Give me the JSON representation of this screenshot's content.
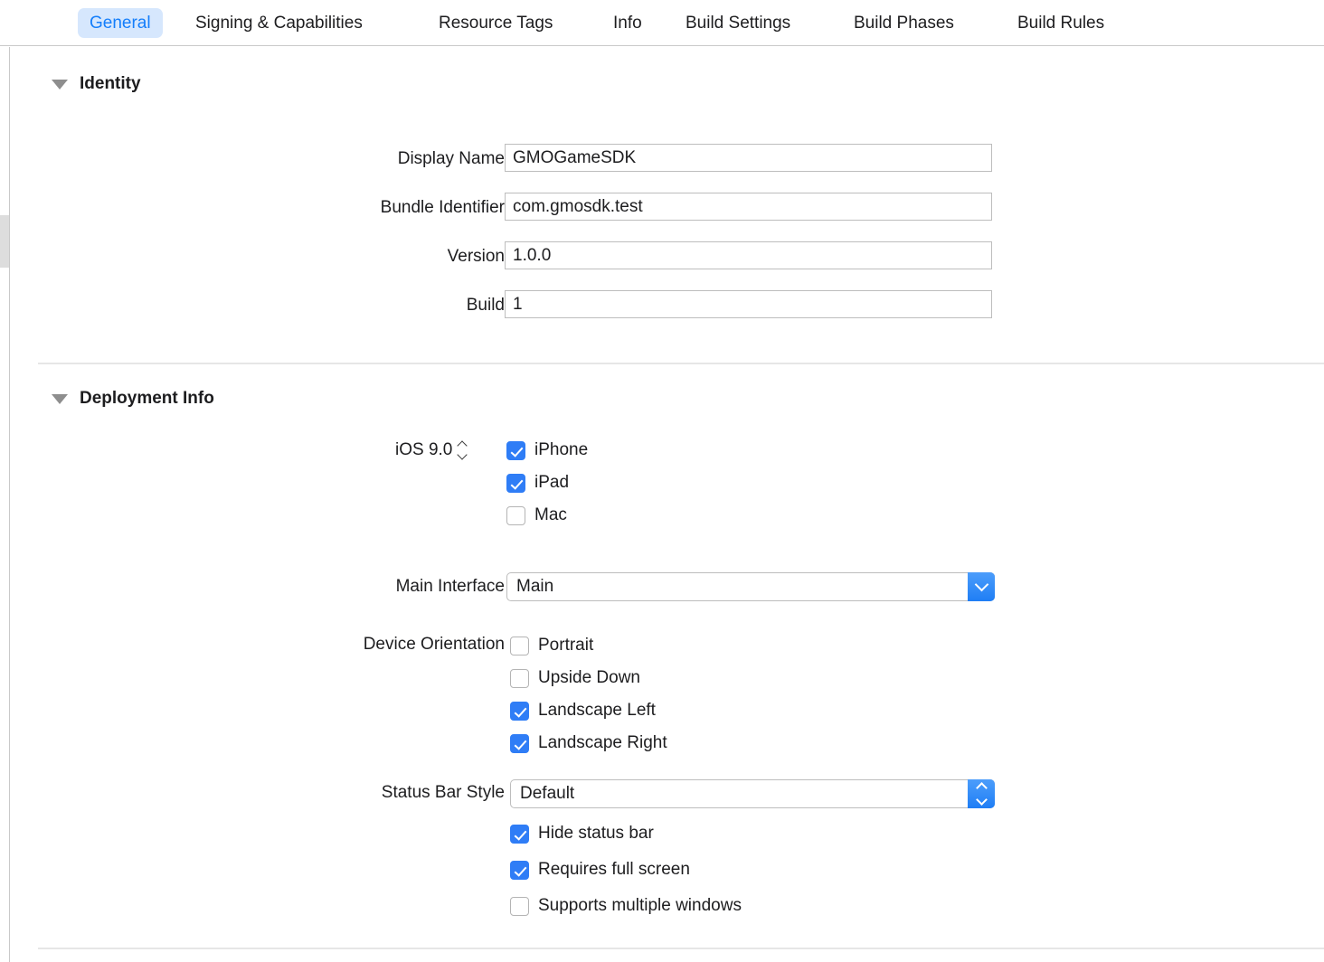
{
  "tabs": [
    {
      "label": "General",
      "selected": true
    },
    {
      "label": "Signing & Capabilities",
      "selected": false
    },
    {
      "label": "Resource Tags",
      "selected": false
    },
    {
      "label": "Info",
      "selected": false
    },
    {
      "label": "Build Settings",
      "selected": false
    },
    {
      "label": "Build Phases",
      "selected": false
    },
    {
      "label": "Build Rules",
      "selected": false
    }
  ],
  "identity": {
    "title": "Identity",
    "fields": [
      {
        "label": "Display Name",
        "value": "GMOGameSDK"
      },
      {
        "label": "Bundle Identifier",
        "value": "com.gmosdk.test"
      },
      {
        "label": "Version",
        "value": "1.0.0"
      },
      {
        "label": "Build",
        "value": "1"
      }
    ]
  },
  "deployment": {
    "title": "Deployment Info",
    "target_label": "iOS 9.0",
    "devices": [
      {
        "label": "iPhone",
        "checked": true
      },
      {
        "label": "iPad",
        "checked": true
      },
      {
        "label": "Mac",
        "checked": false
      }
    ],
    "main_interface": {
      "label": "Main Interface",
      "value": "Main"
    },
    "device_orientation": {
      "label": "Device Orientation",
      "options": [
        {
          "label": "Portrait",
          "checked": false
        },
        {
          "label": "Upside Down",
          "checked": false
        },
        {
          "label": "Landscape Left",
          "checked": true
        },
        {
          "label": "Landscape Right",
          "checked": true
        }
      ]
    },
    "status_bar_style": {
      "label": "Status Bar Style",
      "value": "Default"
    },
    "status_options": [
      {
        "label": "Hide status bar",
        "checked": true
      },
      {
        "label": "Requires full screen",
        "checked": true
      },
      {
        "label": "Supports multiple windows",
        "checked": false
      }
    ]
  },
  "colors": {
    "accent": "#147efb",
    "tab_selected_bg": "#d6e7fd",
    "checkbox_on": "#2f7df6"
  }
}
